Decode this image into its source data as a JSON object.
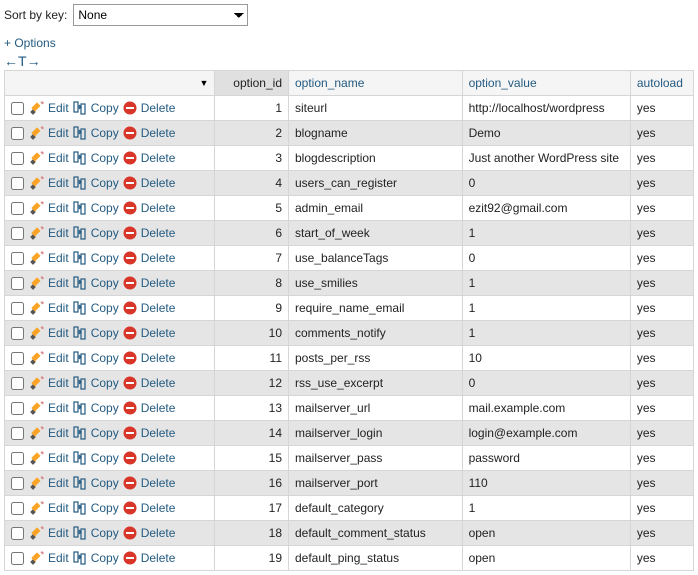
{
  "sort": {
    "label": "Sort by key:",
    "selected": "None"
  },
  "options_link": "+ Options",
  "arrow_symbols": {
    "left": "←",
    "t": "T",
    "right": "→"
  },
  "header_sorted_indicator": "▼",
  "columns": {
    "id": "option_id",
    "name": "option_name",
    "value": "option_value",
    "auto": "autoload"
  },
  "action_labels": {
    "edit": "Edit",
    "copy": "Copy",
    "delete": "Delete"
  },
  "rows": [
    {
      "id": 1,
      "name": "siteurl",
      "value": "http://localhost/wordpress",
      "auto": "yes"
    },
    {
      "id": 2,
      "name": "blogname",
      "value": "Demo",
      "auto": "yes"
    },
    {
      "id": 3,
      "name": "blogdescription",
      "value": "Just another WordPress site",
      "auto": "yes"
    },
    {
      "id": 4,
      "name": "users_can_register",
      "value": "0",
      "auto": "yes"
    },
    {
      "id": 5,
      "name": "admin_email",
      "value": "ezit92@gmail.com",
      "auto": "yes"
    },
    {
      "id": 6,
      "name": "start_of_week",
      "value": "1",
      "auto": "yes"
    },
    {
      "id": 7,
      "name": "use_balanceTags",
      "value": "0",
      "auto": "yes"
    },
    {
      "id": 8,
      "name": "use_smilies",
      "value": "1",
      "auto": "yes"
    },
    {
      "id": 9,
      "name": "require_name_email",
      "value": "1",
      "auto": "yes"
    },
    {
      "id": 10,
      "name": "comments_notify",
      "value": "1",
      "auto": "yes"
    },
    {
      "id": 11,
      "name": "posts_per_rss",
      "value": "10",
      "auto": "yes"
    },
    {
      "id": 12,
      "name": "rss_use_excerpt",
      "value": "0",
      "auto": "yes"
    },
    {
      "id": 13,
      "name": "mailserver_url",
      "value": "mail.example.com",
      "auto": "yes"
    },
    {
      "id": 14,
      "name": "mailserver_login",
      "value": "login@example.com",
      "auto": "yes"
    },
    {
      "id": 15,
      "name": "mailserver_pass",
      "value": "password",
      "auto": "yes"
    },
    {
      "id": 16,
      "name": "mailserver_port",
      "value": "110",
      "auto": "yes"
    },
    {
      "id": 17,
      "name": "default_category",
      "value": "1",
      "auto": "yes"
    },
    {
      "id": 18,
      "name": "default_comment_status",
      "value": "open",
      "auto": "yes"
    },
    {
      "id": 19,
      "name": "default_ping_status",
      "value": "open",
      "auto": "yes"
    }
  ]
}
